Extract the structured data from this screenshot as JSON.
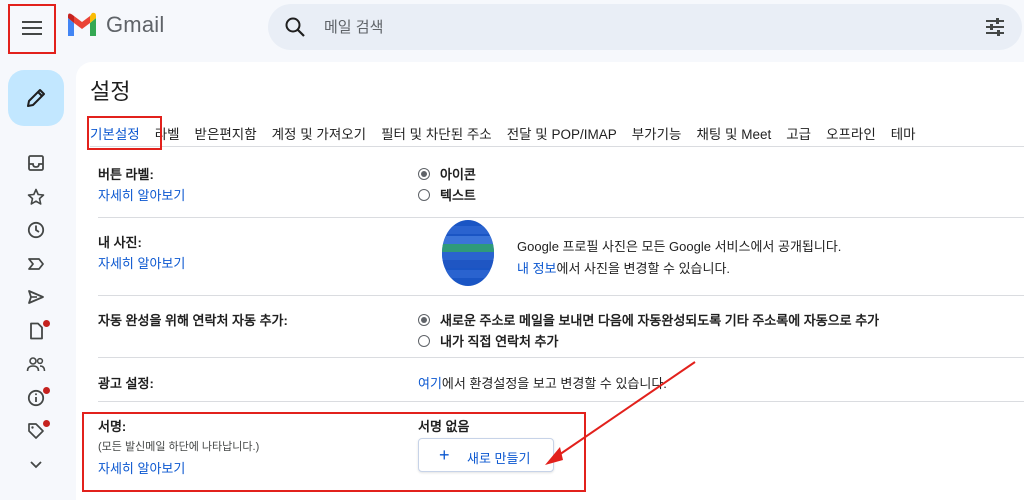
{
  "header": {
    "app_name": "Gmail",
    "search_placeholder": "메일 검색",
    "icons": [
      "menu-icon",
      "gmail-logo-icon",
      "search-icon",
      "tune-icon"
    ]
  },
  "rail": {
    "compose_icon": "pencil-icon",
    "items": [
      {
        "icon": "inbox-icon",
        "badge": false
      },
      {
        "icon": "star-icon",
        "badge": false
      },
      {
        "icon": "clock-icon",
        "badge": false
      },
      {
        "icon": "important-icon",
        "badge": false
      },
      {
        "icon": "send-icon",
        "badge": false
      },
      {
        "icon": "draft-icon",
        "badge": true
      },
      {
        "icon": "contacts-icon",
        "badge": false
      },
      {
        "icon": "info-icon",
        "badge": true
      },
      {
        "icon": "label-icon",
        "badge": true
      },
      {
        "icon": "chevron-down-icon",
        "badge": false
      }
    ]
  },
  "settings": {
    "title": "설정",
    "tabs": [
      {
        "label": "기본설정",
        "active": true
      },
      {
        "label": "라벨",
        "active": false
      },
      {
        "label": "받은편지함",
        "active": false
      },
      {
        "label": "계정 및 가져오기",
        "active": false
      },
      {
        "label": "필터 및 차단된 주소",
        "active": false
      },
      {
        "label": "전달 및 POP/IMAP",
        "active": false
      },
      {
        "label": "부가기능",
        "active": false
      },
      {
        "label": "채팅 및 Meet",
        "active": false
      },
      {
        "label": "고급",
        "active": false
      },
      {
        "label": "오프라인",
        "active": false
      },
      {
        "label": "테마",
        "active": false
      }
    ],
    "learn_more": "자세히 알아보기",
    "button_labels": {
      "label": "버튼 라벨:",
      "options": [
        {
          "label": "아이콘",
          "selected": true
        },
        {
          "label": "텍스트",
          "selected": false
        }
      ]
    },
    "my_picture": {
      "label": "내 사진:",
      "line1": "Google 프로필 사진은 모든 Google 서비스에서 공개됩니다.",
      "link": "내 정보",
      "line2_rest": "에서 사진을 변경할 수 있습니다."
    },
    "autocomplete": {
      "label": "자동 완성을 위해 연락처 자동 추가:",
      "options": [
        {
          "label": "새로운 주소로 메일을 보내면 다음에 자동완성되도록 기타 주소록에 자동으로 추가",
          "selected": true
        },
        {
          "label": "내가 직접 연락처 추가",
          "selected": false
        }
      ]
    },
    "ads": {
      "label": "광고 설정:",
      "link": "여기",
      "rest": "에서 환경설정을 보고 변경할 수 있습니다."
    },
    "signature": {
      "label": "서명:",
      "sub": "(모든 발신메일 하단에 나타납니다.)",
      "status": "서명 없음",
      "new_button": "새로 만들기"
    }
  },
  "colors": {
    "accent": "#0b57d0",
    "compose_bg": "#c2e7ff",
    "annotation": "#e2211c",
    "badge": "#c5221f"
  }
}
